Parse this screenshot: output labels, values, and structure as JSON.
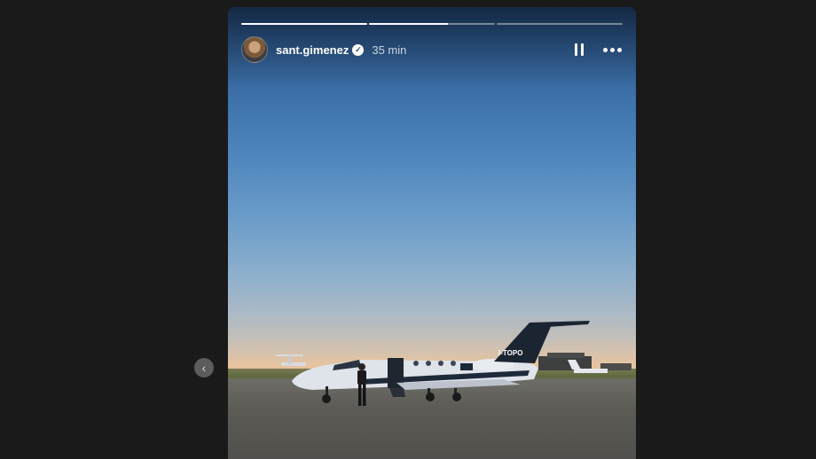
{
  "story": {
    "username": "sant.gimenez",
    "time_ago": "35 min",
    "progress": [
      1.0,
      0.63,
      0.0
    ],
    "aircraft_registration": "I-TOPO"
  },
  "icons": {
    "verified": "verified-badge-icon",
    "pause": "pause-icon",
    "more": "more-options-icon",
    "prev": "chevron-left-icon"
  },
  "colors": {
    "page_background": "#1a1a1a",
    "sky_top": "#1f3f69",
    "sky_horizon": "#e8c49e",
    "tarmac": "#5d5c57"
  }
}
